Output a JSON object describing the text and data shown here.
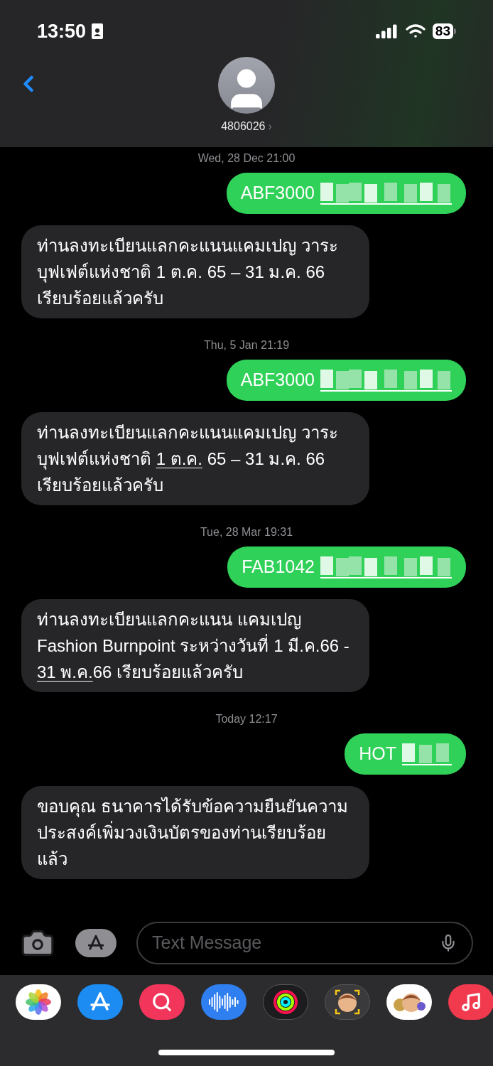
{
  "status_bar": {
    "time": "13:50",
    "battery": "83"
  },
  "contact": {
    "name": "4806026",
    "chevron": "›"
  },
  "messages": [
    {
      "kind": "timestamp",
      "text": "Wed, 28 Dec 21:00"
    },
    {
      "kind": "sent",
      "parts": [
        {
          "text": "ABF3000",
          "link": false
        }
      ],
      "redacted": true
    },
    {
      "kind": "received",
      "parts": [
        {
          "text": "ท่านลงทะเบียนแลกคะแนนแคมเปญ วาระบุฟเฟต์แห่งชาติ 1 ต.ค. 65 – 31 ม.ค. 66 เรียบร้อยแล้วครับ",
          "link": false
        }
      ]
    },
    {
      "kind": "timestamp",
      "text": "Thu, 5 Jan 21:19"
    },
    {
      "kind": "sent",
      "parts": [
        {
          "text": "ABF3000",
          "link": false
        }
      ],
      "redacted": true
    },
    {
      "kind": "received",
      "parts": [
        {
          "text": "ท่านลงทะเบียนแลกคะแนนแคมเปญ วาระบุฟเฟต์แห่งชาติ ",
          "link": false
        },
        {
          "text": "1 ต.ค.",
          "link": true
        },
        {
          "text": " 65 – 31 ม.ค. 66 เรียบร้อยแล้วครับ",
          "link": false
        }
      ]
    },
    {
      "kind": "timestamp",
      "text": "Tue, 28 Mar 19:31"
    },
    {
      "kind": "sent",
      "parts": [
        {
          "text": "FAB1042",
          "link": false
        }
      ],
      "redacted": true
    },
    {
      "kind": "received",
      "parts": [
        {
          "text": "ท่านลงทะเบียนแลกคะแนน แคมเปญ Fashion Burnpoint ระหว่างวันที่ 1 มี.ค.66 - ",
          "link": false
        },
        {
          "text": "31 พ.ค.",
          "link": true
        },
        {
          "text": "66 เรียบร้อยแล้วครับ",
          "link": false
        }
      ]
    },
    {
      "kind": "timestamp",
      "text": "Today 12:17"
    },
    {
      "kind": "sent",
      "parts": [
        {
          "text": "HOT",
          "link": false
        }
      ],
      "redacted": true
    },
    {
      "kind": "received",
      "parts": [
        {
          "text": "ขอบคุณ ธนาคารได้รับข้อความยืนยันความประสงค์เพิ่มวงเงินบัตรของท่านเรียบร้อยแล้ว",
          "link": false
        }
      ]
    }
  ],
  "composer": {
    "placeholder": "Text Message"
  },
  "apps": [
    {
      "kind": "photos"
    },
    {
      "kind": "appstore"
    },
    {
      "kind": "search"
    },
    {
      "kind": "audio"
    },
    {
      "kind": "activity"
    },
    {
      "kind": "avatar"
    },
    {
      "kind": "stickers"
    },
    {
      "kind": "music"
    }
  ]
}
